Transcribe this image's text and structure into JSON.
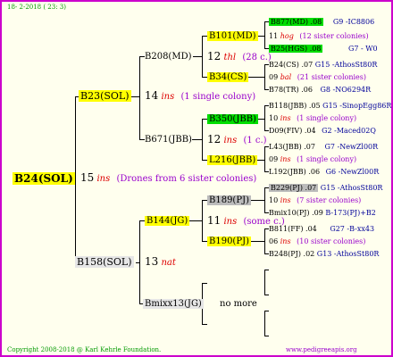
{
  "header": "18- 2-2018 ( 23: 3)",
  "footer": {
    "copyright": "Copyright 2008-2018 @ Karl Kehrle Foundation.",
    "url": "www.pedigreeapis.org"
  },
  "root": {
    "label": "B24(SOL)",
    "count": "15",
    "ins": "ins",
    "note": "(Drones from 6 sister colonies)"
  },
  "b23": {
    "label": "B23(SOL)",
    "count": "14",
    "ins": "ins",
    "note": "(1 single colony)"
  },
  "b158": {
    "label": "B158(SOL)",
    "count": "13",
    "ins": "nat"
  },
  "b208": {
    "label": "B208(MD)"
  },
  "b671": {
    "label": "B671(JBB)"
  },
  "b144": {
    "label": "B144(JG)",
    "count": "11",
    "ins": "ins",
    "note": "(some c.)"
  },
  "bmixx13": {
    "label": "Bmixx13(JG)",
    "more": "no more"
  },
  "b101": {
    "label": "B101(MD)",
    "count": "12",
    "ins": "thl",
    "note": "(28 c.)"
  },
  "b34": {
    "label": "B34(CS)"
  },
  "b350": {
    "label": "B350(JBB)",
    "count": "12",
    "ins": "ins",
    "note": "(1 c.)"
  },
  "l216": {
    "label": "L216(JBB)"
  },
  "b189": {
    "label": "B189(PJ)",
    "count": "10",
    "ins": "ins",
    "note": "(7 sister colonies)"
  },
  "b190": {
    "label": "B190(PJ)"
  },
  "r1": {
    "a": "B877(MD) .08",
    "b": "G9 -IC8806",
    "count": "11",
    "ins": "hog",
    "note": "(12 sister colonies)",
    "c": "B25(HGS) .08",
    "d": "G7 - W0"
  },
  "r2": {
    "a": "B24(CS) .07",
    "b": "G15 -AthosSt80R",
    "count": "09",
    "ins": "bal",
    "note": "(21 sister colonies)",
    "c": "B78(TR) .06",
    "d": "G8 -NO6294R"
  },
  "r3": {
    "a": "B118(JBB) .05",
    "b": "G15 -SinopEgg86R",
    "count": "10",
    "ins": "ins",
    "note": "(1 single colony)",
    "c": "D09(FIV) .04",
    "d": "G2 -Maced02Q"
  },
  "r4": {
    "a": "L43(JBB) .07",
    "b": "G7 -NewZl00R",
    "count": "09",
    "ins": "ins",
    "note": "(1 single colony)",
    "c": "L192(JBB) .06",
    "d": "G6 -NewZl00R"
  },
  "r5": {
    "a": "B229(PJ) .07",
    "b": "G15 -AthosSt80R",
    "count": "10",
    "ins": "ins",
    "note": "(7 sister colonies)",
    "c": "Bmix10(PJ) .09",
    "d": "B-173(PJ)+B2"
  },
  "r6": {
    "a": "B811(FF) .04",
    "b": "G27 -B-xx43",
    "count": "06",
    "ins": "ins",
    "note": "(10 sister colonies)",
    "c": "B248(PJ) .02",
    "d": "G13 -AthosSt80R"
  }
}
